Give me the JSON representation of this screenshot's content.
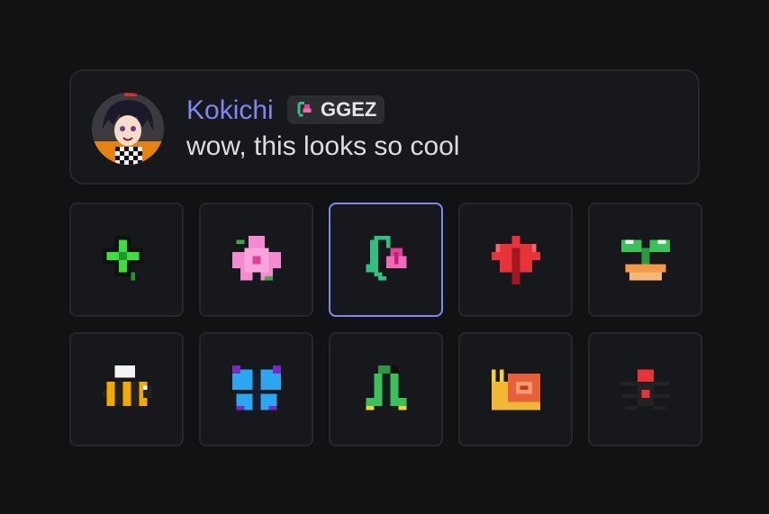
{
  "message": {
    "username": "Kokichi",
    "tag_text": "GGEZ",
    "text": "wow, this looks so cool",
    "username_color": "#7e87f2"
  },
  "tiles": [
    {
      "icon": "clover-icon",
      "selected": false
    },
    {
      "icon": "cherry-blossom-icon",
      "selected": false
    },
    {
      "icon": "bellflower-icon",
      "selected": true
    },
    {
      "icon": "maple-leaf-icon",
      "selected": false
    },
    {
      "icon": "sprout-pot-icon",
      "selected": false
    },
    {
      "icon": "bee-icon",
      "selected": false
    },
    {
      "icon": "butterfly-icon",
      "selected": false
    },
    {
      "icon": "caterpillar-icon",
      "selected": false
    },
    {
      "icon": "snail-icon",
      "selected": false
    },
    {
      "icon": "spider-icon",
      "selected": false
    }
  ],
  "colors": {
    "background": "#111214",
    "card": "#17181b",
    "border": "#26272b",
    "selected_border": "#7e87f2"
  }
}
